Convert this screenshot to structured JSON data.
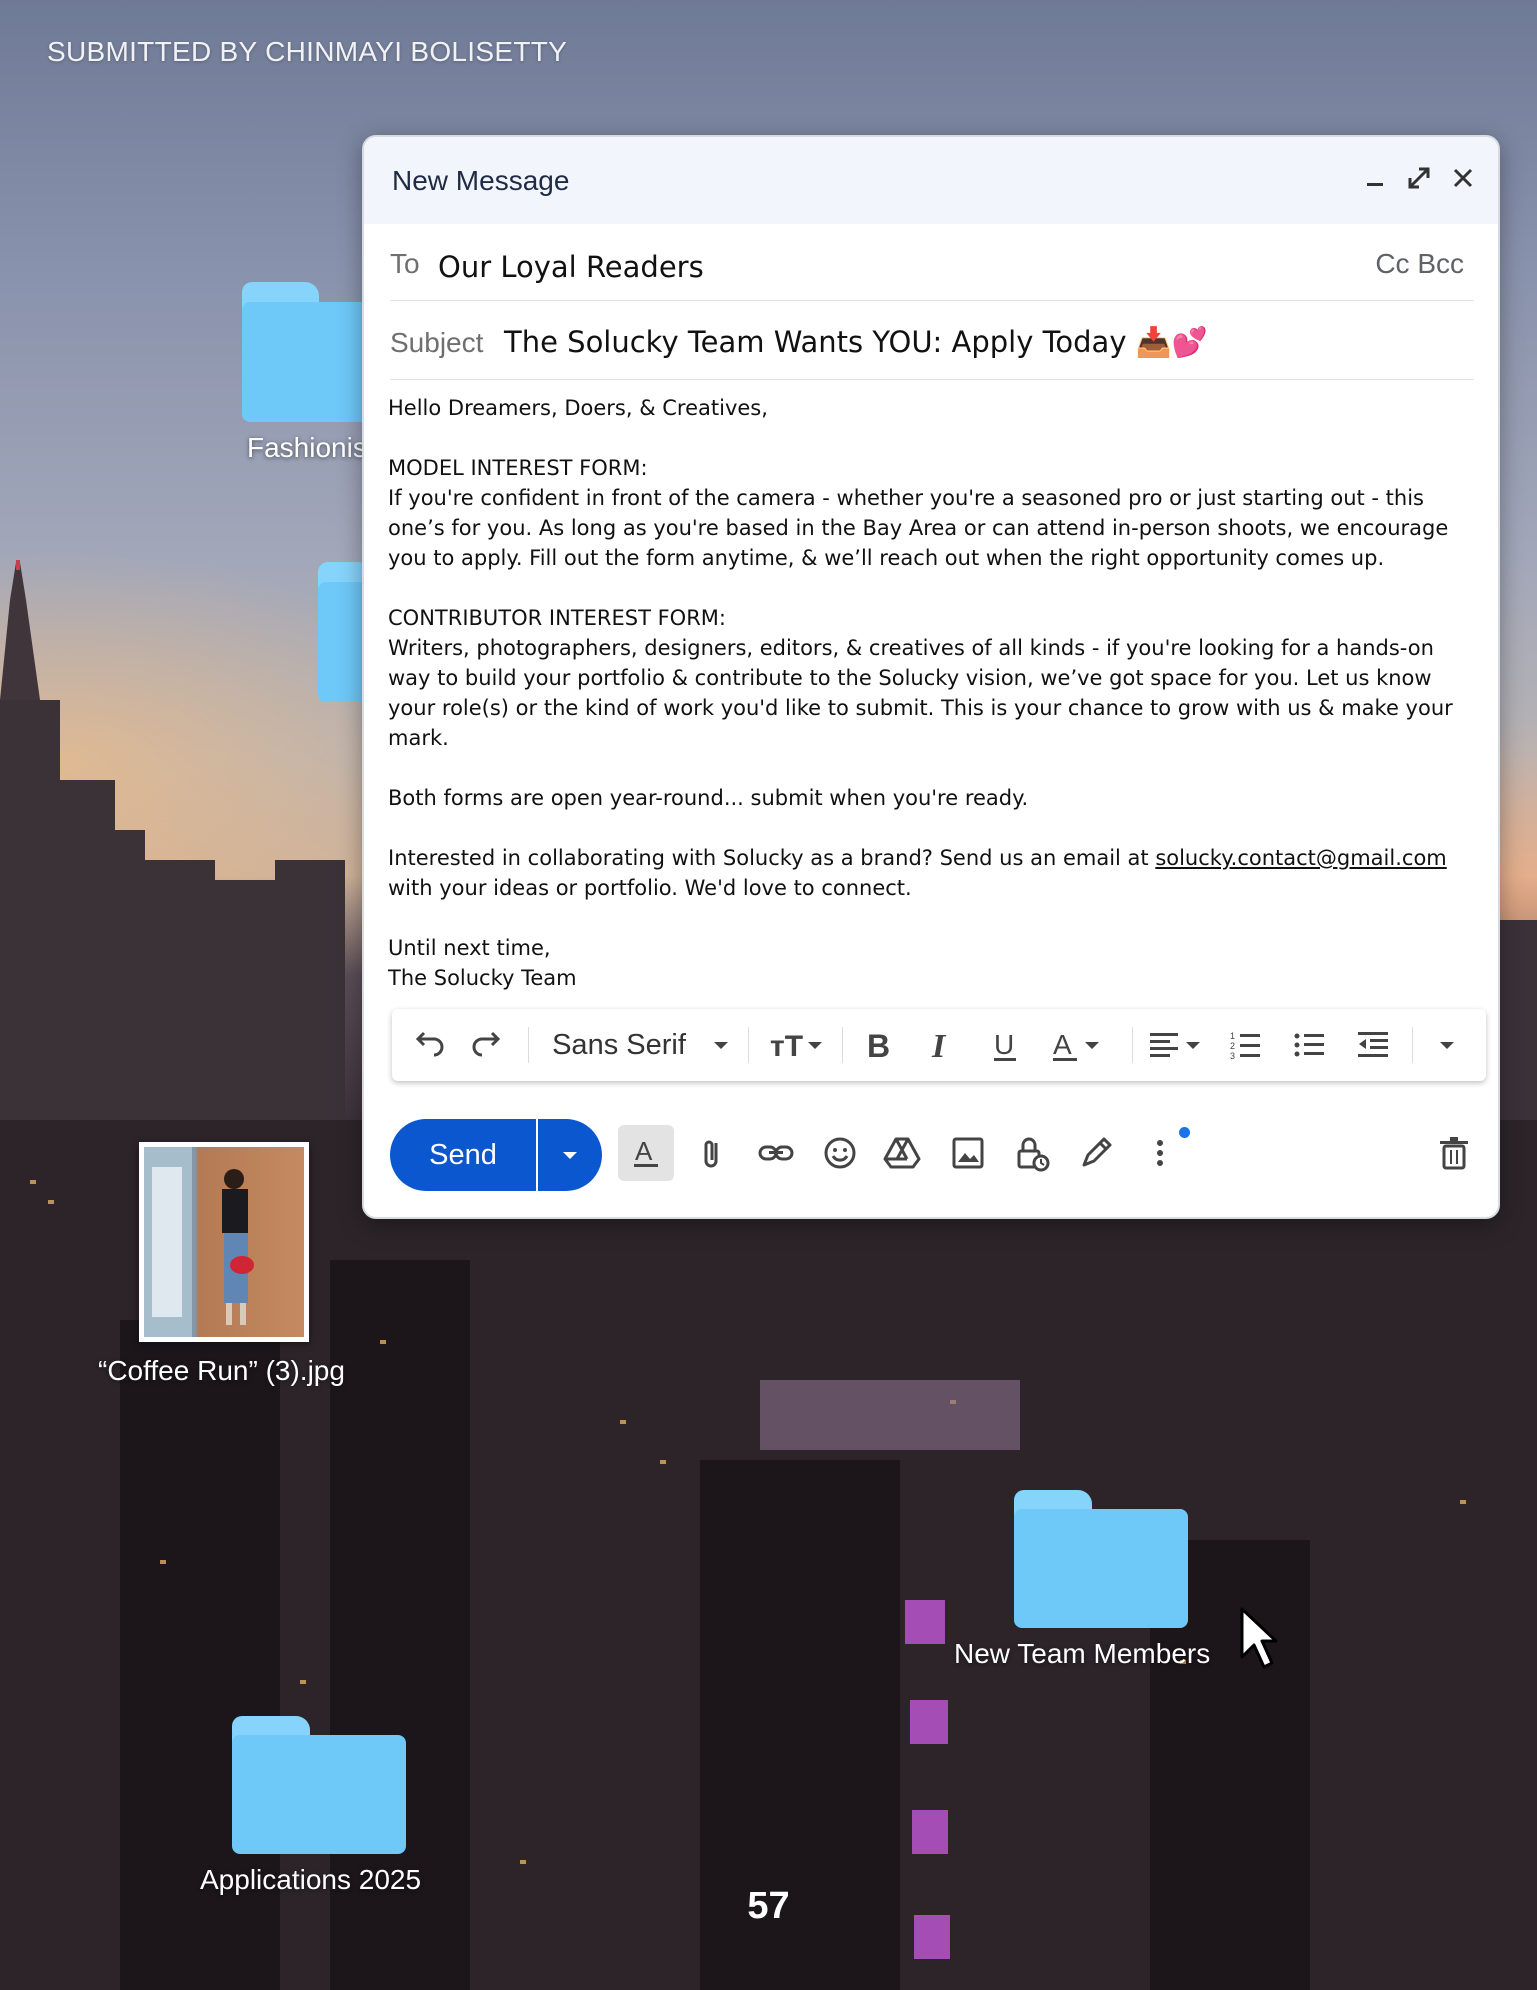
{
  "page_header": {
    "submitted_by": "SUBMITTED BY CHINMAYI BOLISETTY"
  },
  "desktop": {
    "folders": [
      {
        "label": "Fashionis"
      },
      {
        "label": ""
      },
      {
        "label": "New Team Members"
      },
      {
        "label": "Applications 2025"
      }
    ],
    "photo": {
      "label": "“Coffee Run” (3).jpg"
    }
  },
  "compose": {
    "title": "New Message",
    "to_label": "To",
    "to_value": "Our Loyal Readers",
    "cc_bcc": "Cc Bcc",
    "subject_label": "Subject",
    "subject_value": "The Solucky Team Wants YOU: Apply Today 📥💕",
    "body": {
      "greeting": "Hello Dreamers, Doers, & Creatives,",
      "model_heading": "MODEL INTEREST FORM:",
      "model_text": " If you're confident in front of the camera - whether you're a seasoned pro or just starting out - this one’s for you. As long as you're based in the Bay Area or can attend in-person shoots, we encourage you to apply. Fill out the form anytime, & we’ll reach out when the right opportunity comes up.",
      "contributor_heading": "CONTRIBUTOR INTEREST FORM:",
      "contributor_text": "Writers, photographers, designers, editors, & creatives of all kinds - if you're looking for a hands-on way to build your portfolio & contribute to the Solucky vision, we’ve got space for you. Let us know your role(s) or the kind of work you'd like to submit. This is your chance to grow with us & make your mark.",
      "both_forms": "Both forms are open year-round... submit when you're ready.",
      "collab_before": "Interested in collaborating with Solucky as a brand? Send us an email at ",
      "collab_email": "solucky.contact@gmail.com",
      "collab_after": "with your ideas or portfolio. We'd love to connect.",
      "signoff": "Until next time,",
      "signature": "The Solucky Team"
    },
    "toolbar": {
      "font": "Sans Serif"
    },
    "send_label": "Send"
  },
  "page_number": "57",
  "colors": {
    "send_blue": "#0b57d0",
    "folder_blue": "#6ec8f8",
    "header_bg": "#f2f6fc"
  },
  "icons": [
    "minimize-icon",
    "popout-icon",
    "close-icon",
    "undo-icon",
    "redo-icon",
    "text-size-icon",
    "bold-icon",
    "italic-icon",
    "underline-icon",
    "text-color-icon",
    "align-icon",
    "numbered-list-icon",
    "bulleted-list-icon",
    "indent-less-icon",
    "more-formatting-icon",
    "formatting-options-icon",
    "attach-icon",
    "link-icon",
    "emoji-icon",
    "drive-icon",
    "photo-icon",
    "confidential-icon",
    "signature-icon",
    "more-options-icon",
    "trash-icon",
    "mouse-cursor-icon"
  ]
}
